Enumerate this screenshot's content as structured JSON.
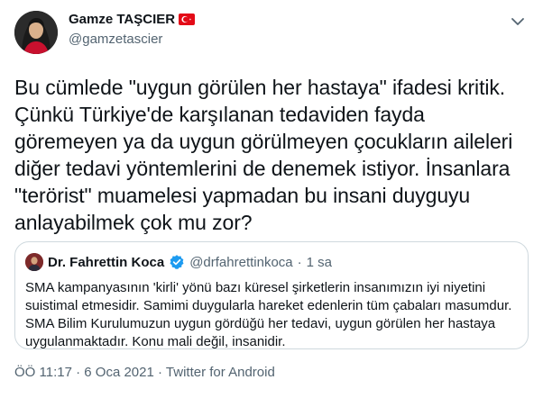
{
  "author": {
    "name": "Gamze TAŞCIER",
    "handle": "@gamzetascier",
    "flag_icon": "turkey-flag-icon"
  },
  "tweet": {
    "lines": [
      "Bu cümlede \"uygun görülen her hastaya\" ifadesi kritik.",
      "Çünkü Türkiye'de karşılanan tedaviden fayda",
      "göremeyen ya da uygun görülmeyen çocukların aileleri",
      "diğer tedavi yöntemlerini de denemek istiyor. İnsanlara",
      "\"terörist\" muamelesi yapmadan bu insani duyguyu",
      "anlayabilmek çok mu zor?"
    ]
  },
  "quoted_tweet": {
    "name": "Dr. Fahrettin Koca",
    "verified_icon": "verified-badge-icon",
    "handle": "@drfahrettinkoca",
    "separator": "·",
    "time": "1 sa",
    "lines": [
      "SMA kampanyasının 'kirli' yönü bazı küresel şirketlerin insanımızın iyi niyetini",
      "suistimal etmesidir. Samimi duygularla hareket edenlerin tüm çabaları masumdur.",
      "SMA Bilim Kurulumuzun uygun gördüğü her tedavi, uygun görülen her hastaya",
      "uygulanmaktadır. Konu mali değil, insanidir."
    ]
  },
  "meta": {
    "time": "ÖÖ 11:17",
    "separator1": " · ",
    "date": "6 Oca 2021",
    "separator2": " · ",
    "client": "Twitter for Android"
  },
  "colors": {
    "text": "#0f1419",
    "secondary": "#536471",
    "border": "#cfd9de",
    "verified": "#1d9bf0",
    "flag_red": "#e30a17"
  }
}
